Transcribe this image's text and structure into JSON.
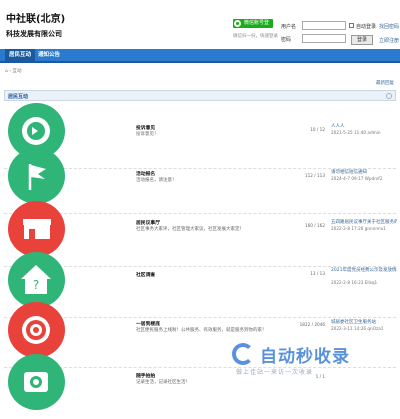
{
  "header": {
    "logo_line1": "中社联(北京)",
    "logo_line2": "科技发展有限公司",
    "wechat_button": "微信账号登录",
    "wechat_sub": "微信扫一扫，快速登录",
    "username_label": "用户名",
    "password_label": "密码",
    "remember_label": "自动登录",
    "forgot_label": "找回密码",
    "login_button": "登录",
    "register_label": "立即注册"
  },
  "nav": {
    "items": [
      "居民互动",
      "通知公告"
    ]
  },
  "breadcrumb": {
    "home_icon": "home-icon",
    "sep": "›",
    "current": "互动"
  },
  "new_post_label": "最新回复",
  "section": {
    "title": "居民互动"
  },
  "forums": [
    {
      "icon": "audio-icon",
      "color": "#2fb577",
      "title": "投诉意见",
      "desc": "投诉意见！",
      "count": "10 / 12",
      "last": "人人人",
      "time": "2021-5-25 11:40 admin"
    },
    {
      "icon": "flag-icon",
      "color": "#2fb577",
      "title": "活动报名",
      "desc": "活动报名，请注意！",
      "count": "112 / 113",
      "last": "请勿相信短信通知",
      "time": "2024-4-7 09:17 Wpdrxf2"
    },
    {
      "icon": "shop-icon",
      "color": "#e8423b",
      "title": "居民议事厅",
      "desc": "社区事务大家评，社区管理大家议，社区发展大家定！",
      "count": "160 / 162",
      "last": "五四路居民议事厅关于社区服务的建议",
      "time": "2022-2-8 17:26 gnnnnnx1"
    },
    {
      "icon": "house-icon",
      "color": "#2fb577",
      "title": "社区调查",
      "desc": "",
      "count": "13 / 13",
      "last": "2021年度党员经费公示及发放情况的说明",
      "time": "2022-2-8 16:23 Ellsq1"
    },
    {
      "icon": "target-icon",
      "color": "#e8423b",
      "title": "一居到楼底",
      "desc": "社区便民服务上线啦！公共服务、有效服务，就是服务到你的家！",
      "count": "1822 / 2046",
      "last": "城居委社区卫生服务站",
      "time": "2022-3-11 14:26 qnOza1"
    },
    {
      "icon": "camera-icon",
      "color": "#2fb577",
      "title": "随手拍拍",
      "desc": "记录生活，记录社区生活！",
      "count": "1 / 1",
      "last": "",
      "time": ""
    }
  ],
  "watermark": {
    "big": "自动秒收录",
    "small": "做上佳站一来访一次收录"
  }
}
